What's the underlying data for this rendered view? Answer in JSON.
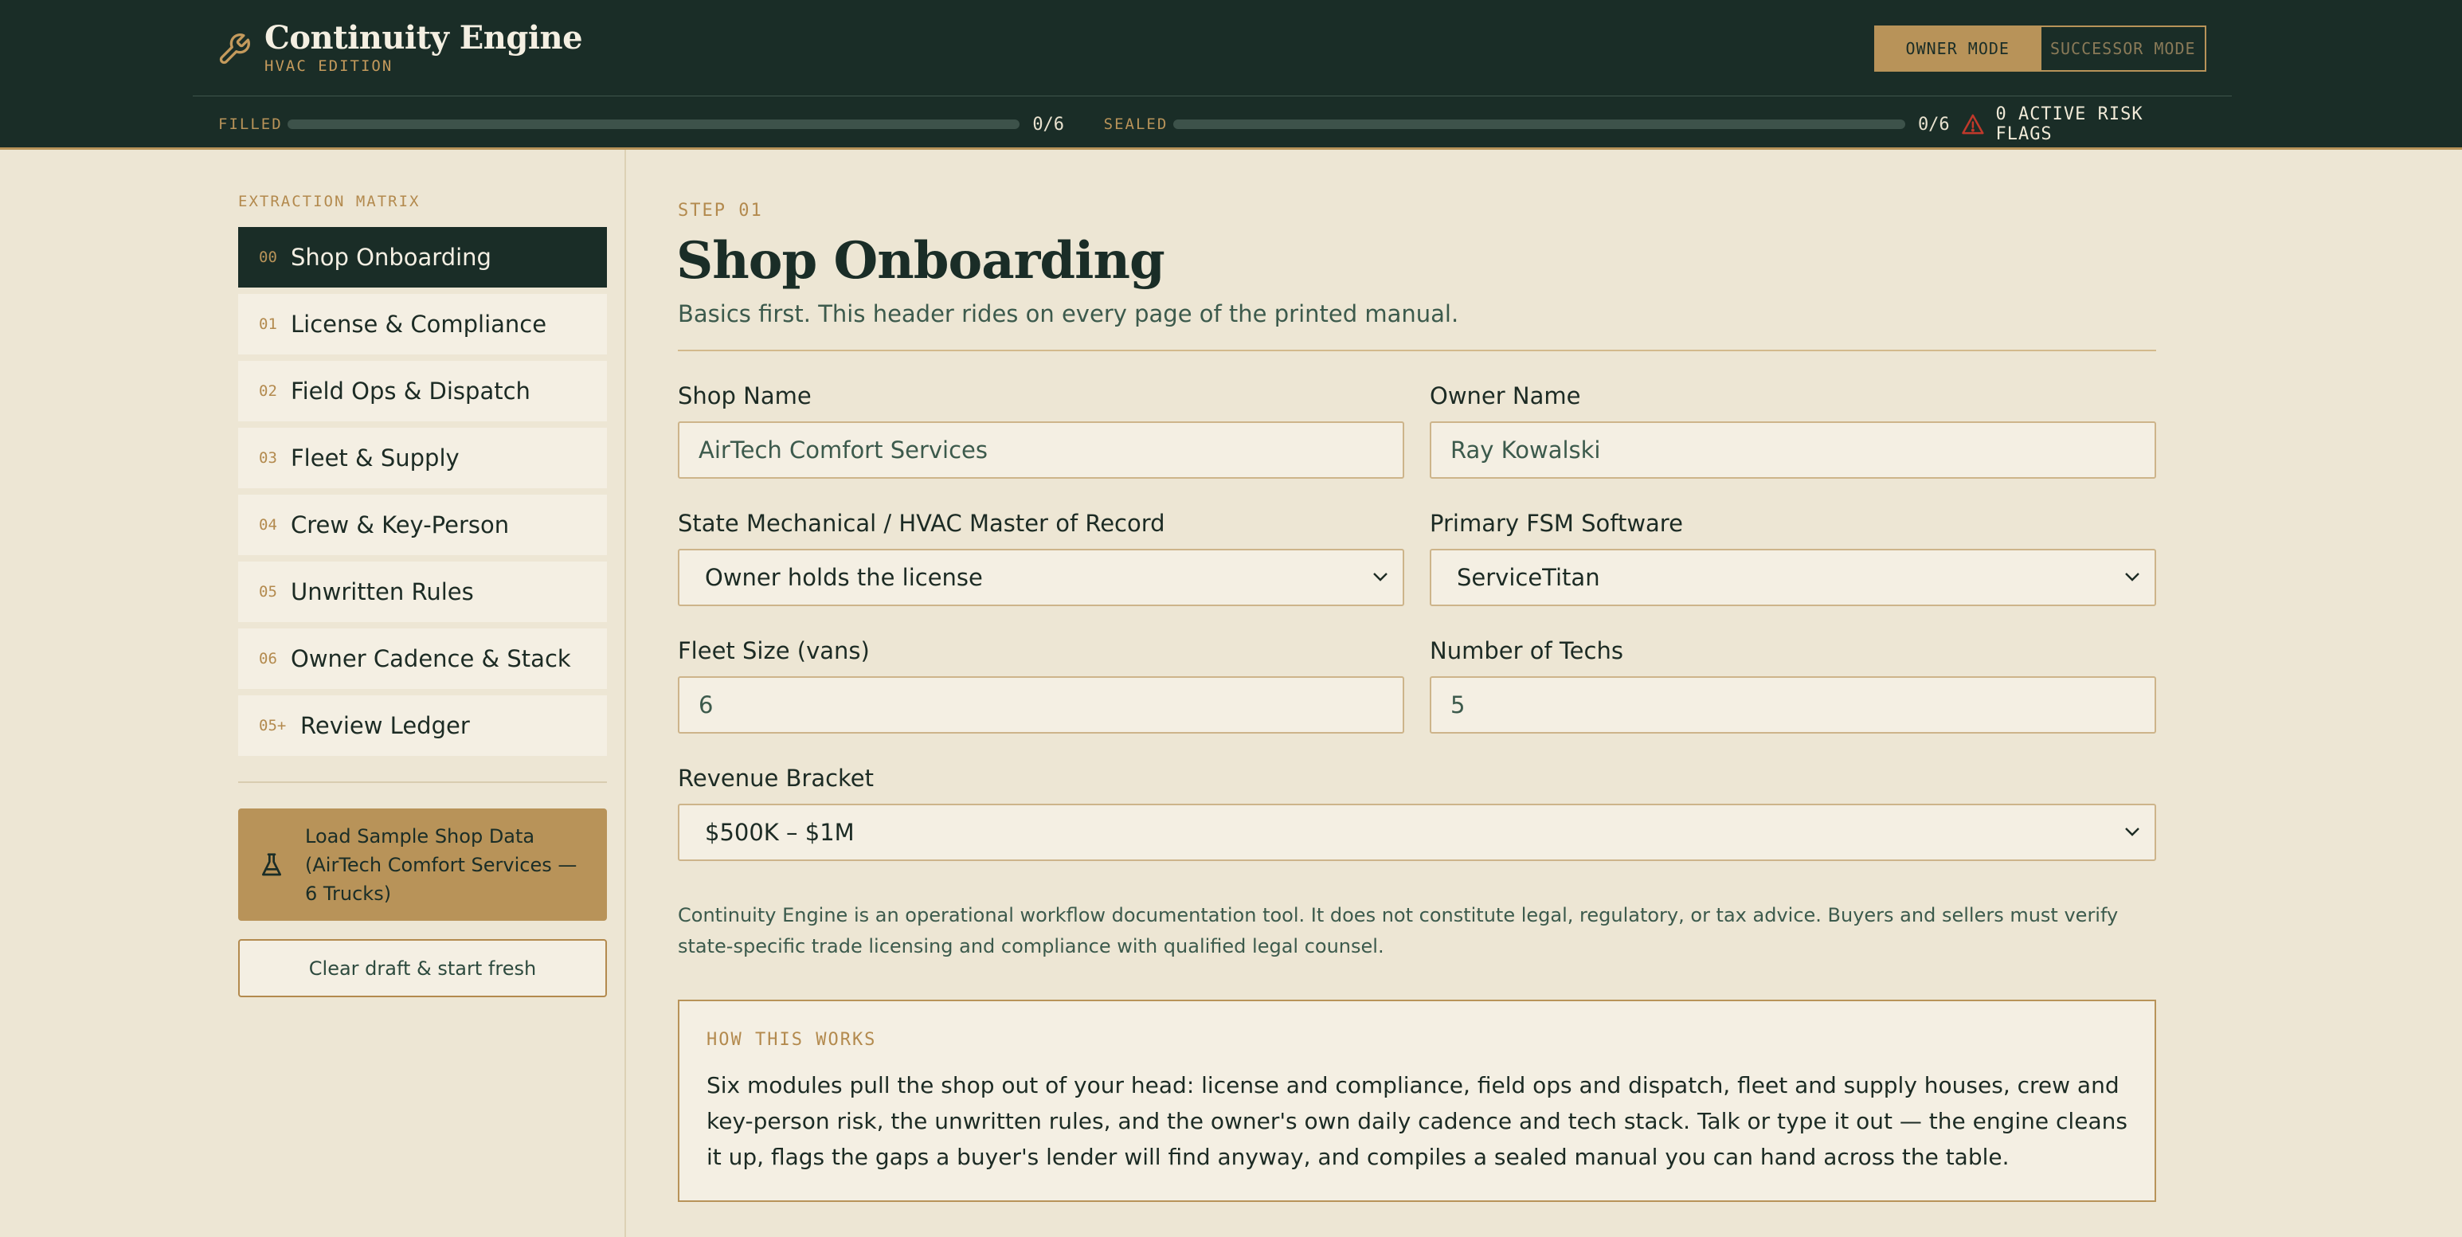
{
  "brand": {
    "title": "Continuity Engine",
    "edition": "HVAC EDITION",
    "icon": "wrench-icon"
  },
  "modes": {
    "owner": "OWNER MODE",
    "successor": "SUCCESSOR MODE",
    "active": "owner"
  },
  "progress": {
    "filled_label": "FILLED",
    "filled_count": "0/6",
    "filled_fraction": 0,
    "sealed_label": "SEALED",
    "sealed_count": "0/6",
    "sealed_fraction": 0,
    "risk_text": "0 ACTIVE RISK FLAGS",
    "risk_icon": "warning-triangle-icon"
  },
  "sidebar": {
    "section_label": "EXTRACTION MATRIX",
    "items": [
      {
        "num": "00",
        "label": "Shop Onboarding",
        "active": true
      },
      {
        "num": "01",
        "label": "License & Compliance"
      },
      {
        "num": "02",
        "label": "Field Ops & Dispatch"
      },
      {
        "num": "03",
        "label": "Fleet & Supply"
      },
      {
        "num": "04",
        "label": "Crew & Key-Person"
      },
      {
        "num": "05",
        "label": "Unwritten Rules"
      },
      {
        "num": "06",
        "label": "Owner Cadence & Stack"
      },
      {
        "num": "05+",
        "label": "Review Ledger"
      }
    ],
    "sample_button": "Load Sample Shop Data (AirTech Comfort Services — 6 Trucks)",
    "sample_icon": "flask-icon",
    "clear_button": "Clear draft & start fresh"
  },
  "main": {
    "step": "STEP 01",
    "title": "Shop Onboarding",
    "subtitle": "Basics first. This header rides on every page of the printed manual.",
    "fields": {
      "shop_name": {
        "label": "Shop Name",
        "value": "AirTech Comfort Services"
      },
      "owner_name": {
        "label": "Owner Name",
        "value": "Ray Kowalski"
      },
      "license_holder": {
        "label": "State Mechanical / HVAC Master of Record",
        "value": "Owner holds the license"
      },
      "fsm_software": {
        "label": "Primary FSM Software",
        "value": "ServiceTitan"
      },
      "fleet_size": {
        "label": "Fleet Size (vans)",
        "value": "6"
      },
      "num_techs": {
        "label": "Number of Techs",
        "value": "5"
      },
      "revenue": {
        "label": "Revenue Bracket",
        "value": "$500K – $1M"
      }
    },
    "disclaimer": "Continuity Engine is an operational workflow documentation tool. It does not constitute legal, regulatory, or tax advice. Buyers and sellers must verify state-specific trade licensing and compliance with qualified legal counsel.",
    "how": {
      "title": "HOW THIS WORKS",
      "body": "Six modules pull the shop out of your head: license and compliance, field ops and dispatch, fleet and supply houses, crew and key-person risk, the unwritten rules, and the owner's own daily cadence and tech stack. Talk or type it out — the engine cleans it up, flags the gaps a buyer's lender will find anyway, and compiles a sealed manual you can hand across the table."
    }
  },
  "colors": {
    "header_bg": "#1a2d27",
    "accent": "#b89359",
    "page_bg": "#ede6d4",
    "risk": "#c0392b"
  }
}
